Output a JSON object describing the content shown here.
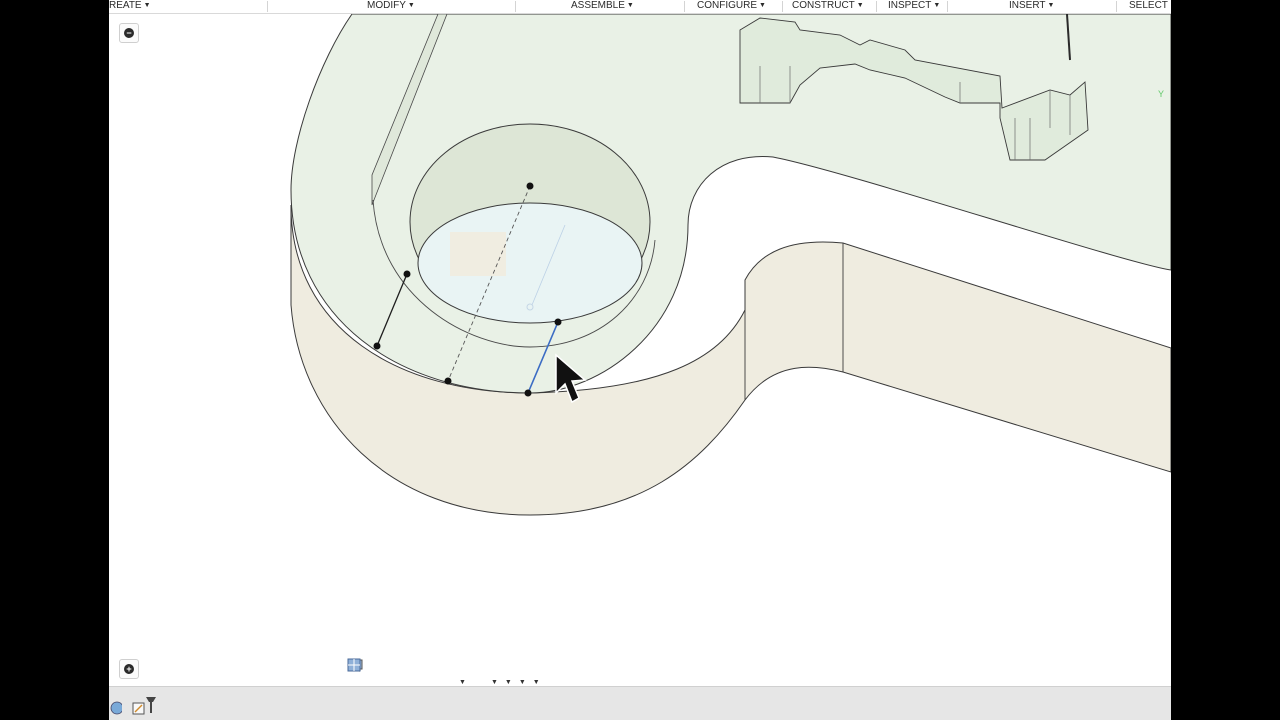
{
  "toolbar": {
    "create": "REATE",
    "modify": "MODIFY",
    "assemble": "ASSEMBLE",
    "configure": "CONFIGURE",
    "construct": "CONSTRUCT",
    "inspect": "INSPECT",
    "insert": "INSERT",
    "select": "SELECT"
  },
  "viewcube": {
    "axis_label": "Y"
  },
  "icons": {
    "collapse": "minus-icon",
    "expand": "plus-icon",
    "orbit": "orbit-icon",
    "look_at": "look-at-icon",
    "pan": "pan-hand-icon",
    "zoom": "zoom-icon",
    "fit": "zoom-window-icon",
    "display": "display-settings-icon",
    "grid": "grid-snap-icon",
    "viewports": "viewports-icon"
  },
  "colors": {
    "top_face": "#e9f1e6",
    "side_face": "#efece0",
    "edge": "#3a3a3a",
    "selected_edge": "#3b6cc4"
  }
}
